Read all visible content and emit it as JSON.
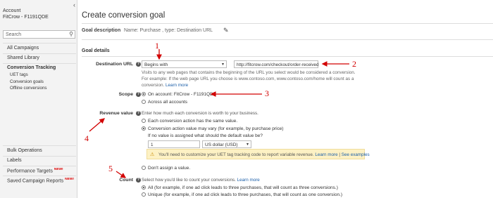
{
  "sidebar": {
    "account_label": "Account",
    "account_id": "FitCrow - F1191QDE",
    "search_placeholder": "Search",
    "items": [
      "All Campaigns",
      "Shared Library",
      "Conversion Tracking"
    ],
    "sub_items": [
      "UET tags",
      "Conversion goals",
      "Offline conversions"
    ],
    "bottom_items": [
      "Bulk Operations",
      "Labels",
      "Performance Targets",
      "Saved Campaign Reports"
    ],
    "new_badge": "NEW!"
  },
  "main": {
    "title": "Create conversion goal",
    "goal_description_label": "Goal description",
    "goal_description_value": "Name: Purchase , type: Destination URL",
    "section_title": "Goal details",
    "destination_url": {
      "label": "Destination URL",
      "match_type": "Begins with",
      "url_value": "http://fitcrow.com/checkout/order-received",
      "desc1": "Visits to any web pages that contains the beginning of the URL you select would be considered a conversion.",
      "desc2": "For example: If the web page URL you choose is www.contoso.com, www.contoso.com/home will count as a",
      "desc3": "conversion.",
      "learn_more": "Learn more"
    },
    "scope": {
      "label": "Scope",
      "opt1": "On account: FitCrow - F1191QDE",
      "opt2": "Across all accounts"
    },
    "revenue": {
      "label": "Revenue value",
      "desc": "Enter how much each conversion is worth to your business.",
      "opt1": "Each conversion action has the same value.",
      "opt2": "Conversion action value may vary (for example, by purchase price)",
      "default_q": "If no value is assigned what should the default value be?",
      "default_value": "1",
      "currency": "US dollar (USD)",
      "warn_text": "You'll need to customize your UET tag tracking code to report variable revenue.",
      "warn_link1": "Learn more",
      "warn_sep": "|",
      "warn_link2": "See examples",
      "opt3": "Don't assign a value."
    },
    "count": {
      "label": "Count",
      "desc": "Select how you'd like to count your conversions.",
      "learn_more": "Learn more",
      "opt1": "All (for example, if one ad click leads to three purchases, that will count as three conversions.)",
      "opt2": "Unique (for example, if one ad click leads to three purchases, that will count as one conversion.)"
    }
  },
  "annotations": [
    "1",
    "2",
    "3",
    "4",
    "5"
  ],
  "colors": {
    "annotation": "#d20000",
    "link": "#1a5ea8",
    "warning_bg": "#fdf1c4"
  }
}
